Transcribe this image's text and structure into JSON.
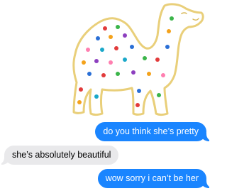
{
  "sticker": {
    "icon": "frosted-animal-cracker-camel-icon",
    "colors": {
      "body": "#ffffff",
      "outline": "#e9cf7a",
      "sprinkles": [
        "#e23b3b",
        "#2a6fd6",
        "#3bb54a",
        "#f4a21b",
        "#8d3fbf",
        "#ff7fb0",
        "#1aa8c9"
      ]
    }
  },
  "messages": [
    {
      "direction": "sent",
      "text": "do you think she’s pretty"
    },
    {
      "direction": "received",
      "text": "she’s absolutely beautiful"
    },
    {
      "direction": "sent",
      "text": "wow sorry i can’t be her"
    }
  ],
  "colors": {
    "sent_bubble": "#1a85ff",
    "received_bubble": "#e9e9eb"
  }
}
